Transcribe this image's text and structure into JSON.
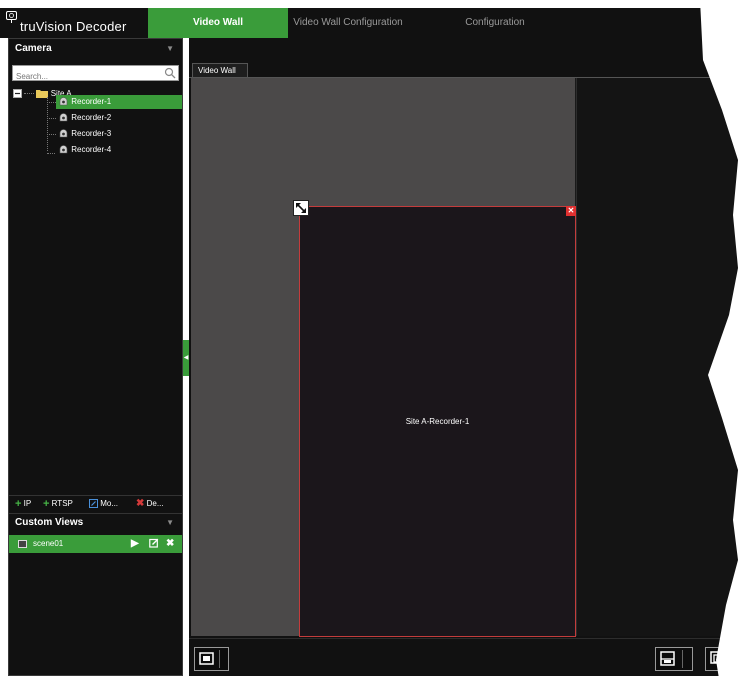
{
  "app": {
    "title": "truVision Decoder",
    "logo_icon": "tv-monitor-icon"
  },
  "tabs": [
    {
      "label": "Video Wall",
      "active": true
    },
    {
      "label": "Video Wall Configuration",
      "active": false
    },
    {
      "label": "Configuration",
      "active": false
    }
  ],
  "camera_panel": {
    "title": "Camera",
    "search_placeholder": "Search...",
    "tree": {
      "site": {
        "label": "Site A",
        "expanded": true
      },
      "recorders": [
        {
          "label": "Recorder-1",
          "selected": true
        },
        {
          "label": "Recorder-2",
          "selected": false
        },
        {
          "label": "Recorder-3",
          "selected": false
        },
        {
          "label": "Recorder-4",
          "selected": false
        }
      ]
    },
    "toolbar": [
      {
        "label": "IP",
        "icon": "plus-icon"
      },
      {
        "label": "RTSP",
        "icon": "plus-icon"
      },
      {
        "label": "Mo...",
        "icon": "edit-icon"
      },
      {
        "label": "De...",
        "icon": "delete-icon"
      }
    ]
  },
  "custom_views": {
    "title": "Custom Views",
    "items": [
      {
        "label": "scene01",
        "selected": true,
        "actions": [
          "play-icon",
          "edit-icon",
          "delete-icon"
        ]
      }
    ]
  },
  "video_wall": {
    "tab_label": "Video Wall",
    "window_label": "Site A-Recorder-1"
  },
  "colors": {
    "accent_green": "#3a9c3a",
    "header_bg": "#111111",
    "window_border": "#c43c3c",
    "close_red": "#e03030"
  }
}
